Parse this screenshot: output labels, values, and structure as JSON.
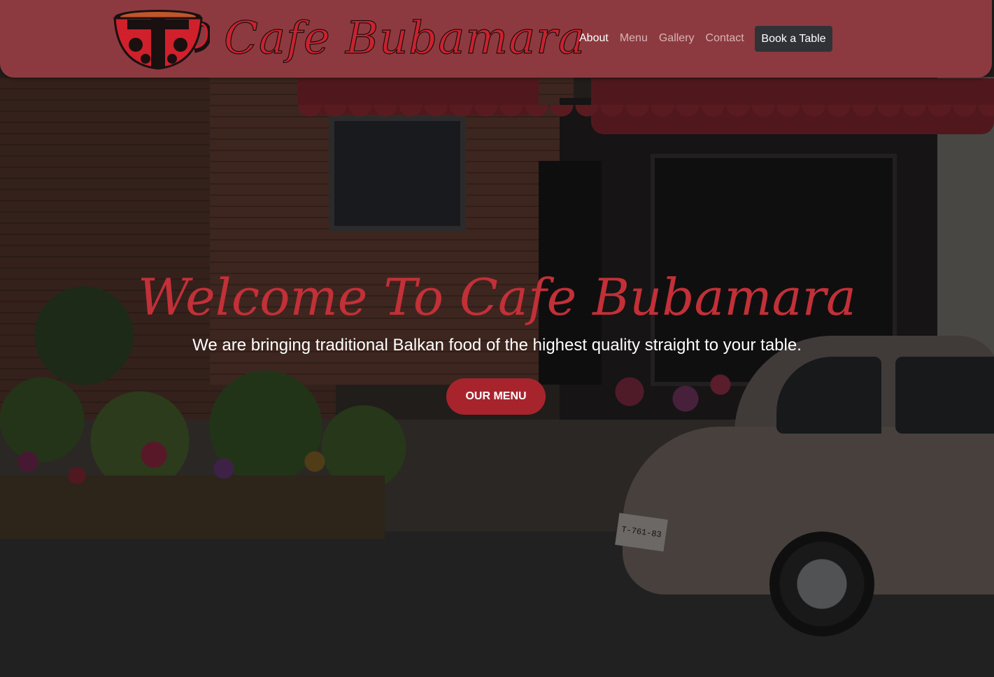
{
  "header": {
    "brand": "Cafe Bubamara",
    "logo_icon": "ladybug-coffee-cup-icon",
    "nav": [
      {
        "label": "About",
        "active": true
      },
      {
        "label": "Menu",
        "active": false
      },
      {
        "label": "Gallery",
        "active": false
      },
      {
        "label": "Contact",
        "active": false
      }
    ],
    "cta_label": "Book a Table"
  },
  "hero": {
    "title": "Welcome To Cafe Bubamara",
    "subtitle": "We are bringing traditional Balkan food of the highest quality straight to your table.",
    "button_label": "OUR MENU",
    "plate_text": "T-761-83"
  },
  "colors": {
    "header_bg": "#8c3a40",
    "brand_red": "#c8232f",
    "title_red": "#c23038",
    "button_red": "#a8242d",
    "cta_bg": "#303236"
  }
}
